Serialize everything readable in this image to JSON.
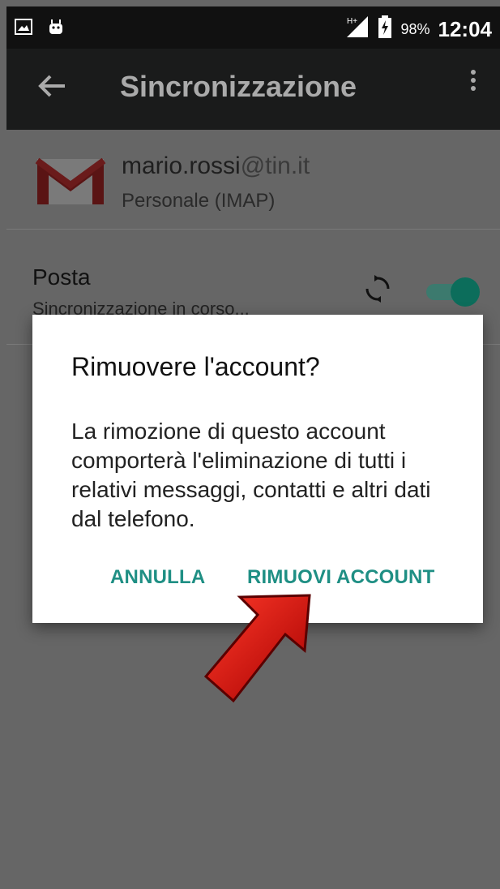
{
  "statusbar": {
    "battery_percent": "98%",
    "time": "12:04"
  },
  "toolbar": {
    "title": "Sincronizzazione"
  },
  "account": {
    "email_user": "mario.rossi",
    "email_domain": "@tin.it",
    "type": "Personale (IMAP)"
  },
  "sync_items": [
    {
      "label": "Posta",
      "status": "Sincronizzazione in corso..."
    }
  ],
  "dialog": {
    "title": "Rimuovere l'account?",
    "message": "La rimozione di questo account comporterà l'eliminazione di tutti i relativi messaggi, contatti e altri dati dal telefono.",
    "cancel_label": "ANNULLA",
    "confirm_label": "RIMUOVI ACCOUNT"
  }
}
